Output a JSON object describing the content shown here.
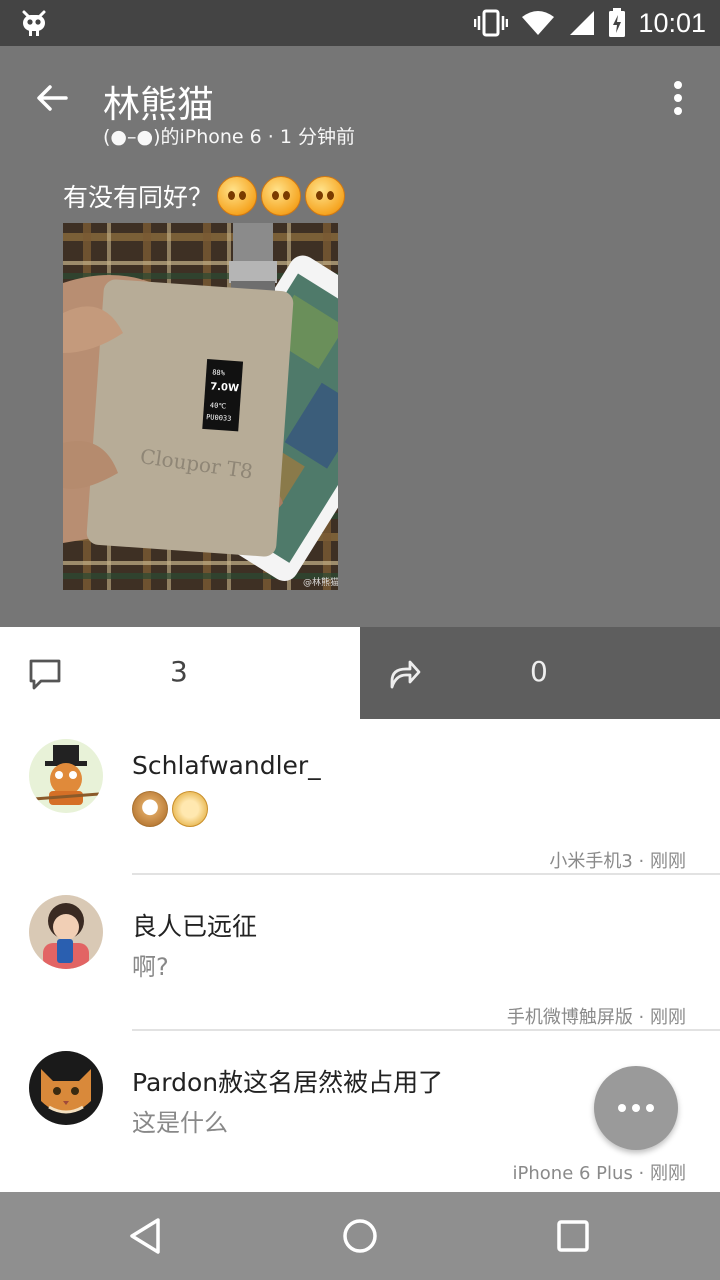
{
  "status_bar": {
    "time": "10:01",
    "icons": [
      "cyanogen-icon",
      "vibrate-icon",
      "wifi-icon",
      "signal-icon",
      "battery-charging-icon"
    ]
  },
  "header": {
    "title": "林熊猫",
    "subtitle": "(●–●)的iPhone 6 · 1 分钟前",
    "back_icon": "arrow-back-icon",
    "menu_icon": "more-vert-icon"
  },
  "post": {
    "text": "有没有同好？",
    "emoji_count": 3,
    "image_alt": "hand holding Cloupor T8 vape mod",
    "image_device_screen": [
      "88%",
      "7.0W",
      "40℃",
      "PU0033"
    ],
    "image_brand": "Cloupor T8",
    "image_watermark": "@林熊猫"
  },
  "actions": {
    "comment_count": "3",
    "repost_count": "0"
  },
  "comments": [
    {
      "name": "Schlafwandler_",
      "body": "",
      "meta": "小米手机3 · 刚刚",
      "has_stickers": true
    },
    {
      "name": "良人已远征",
      "body": "啊?",
      "meta": "手机微博触屏版 · 刚刚"
    },
    {
      "name": "Pardon赦这名居然被占用了",
      "body": "这是什么",
      "meta": "iPhone 6 Plus · 刚刚"
    }
  ],
  "colors": {
    "header_bg": "#767676",
    "status_bg": "#444444",
    "repost_tab_bg": "#5e5e5e",
    "nav_bg": "#8f8f8f",
    "fab_bg": "#9a9a9a"
  }
}
